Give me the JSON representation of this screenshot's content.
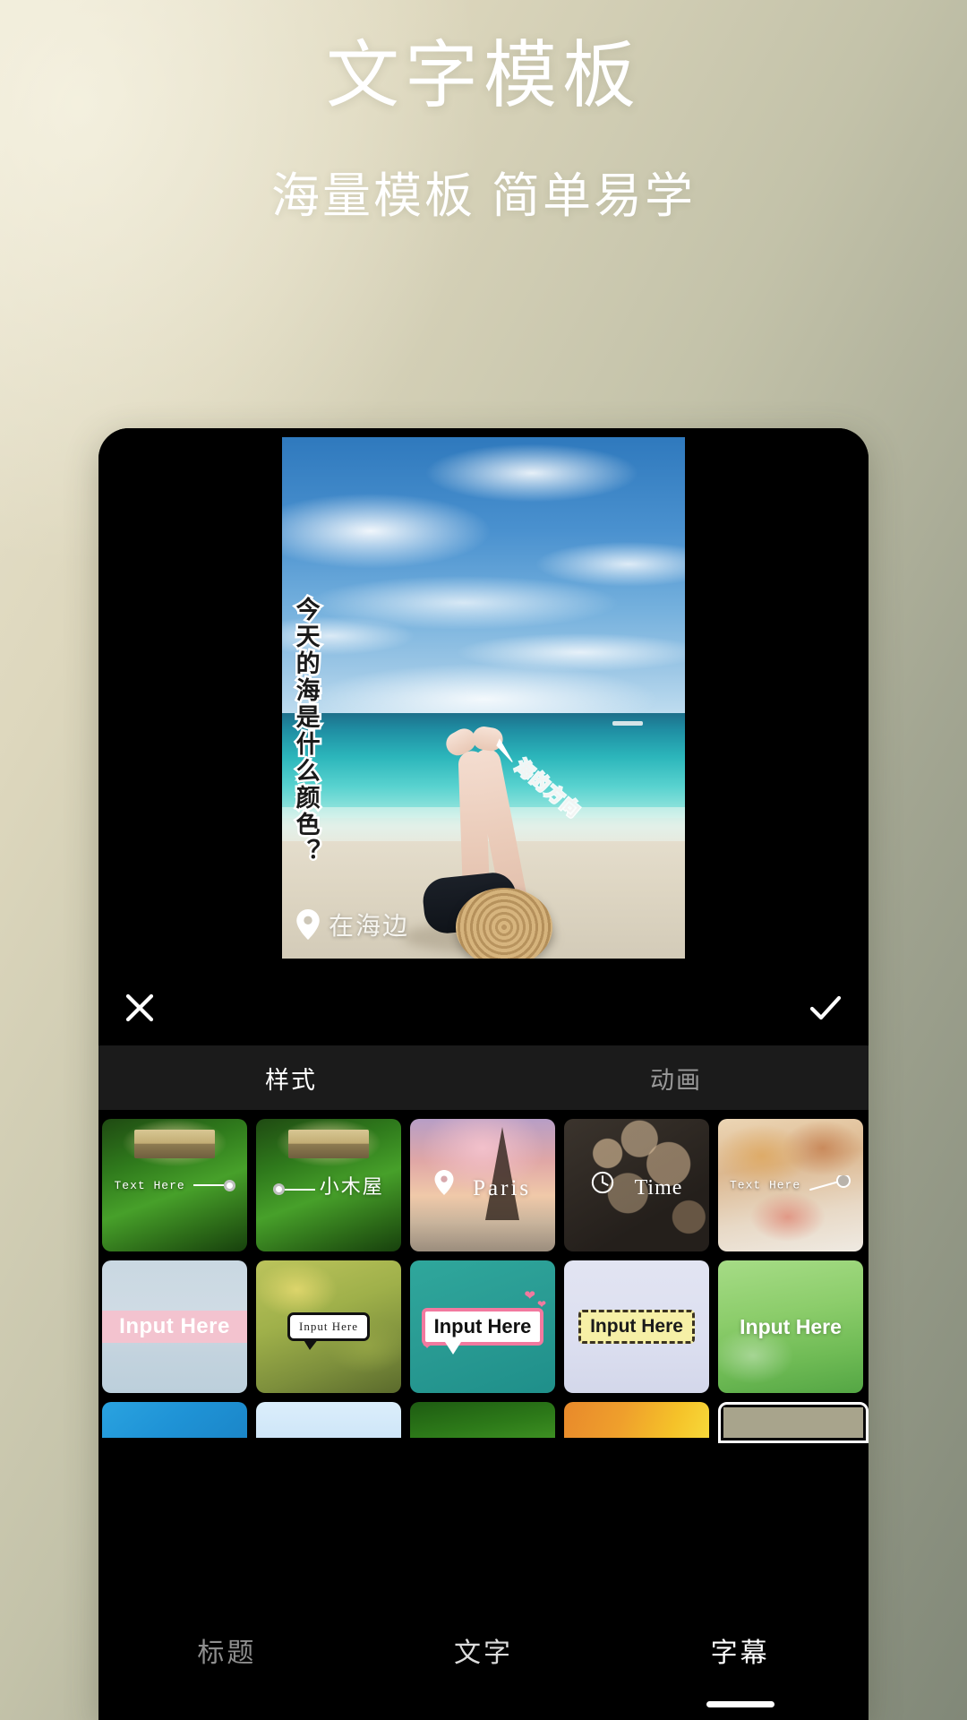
{
  "promo": {
    "headline": "文字模板",
    "subhead": "海量模板 简单易学"
  },
  "colors": {
    "bg_start": "#eae4cf",
    "bg_end": "#818878",
    "phone_bg": "#000000",
    "tabbar_bg": "#1b1b1b",
    "accent_white": "#ffffff",
    "muted_text": "#9a9a9a",
    "pink_accent": "#f2799f",
    "yellow_tag": "#f6f0a6"
  },
  "preview": {
    "vertical_caption": "今天的海是什么颜色？",
    "diagonal_caption": "海的方向",
    "diagonal_arrow_icon": "arrow-up-left-icon",
    "location_icon": "location-pin-icon",
    "location_label": "在海边"
  },
  "actions": {
    "close_icon": "close-x-icon",
    "confirm_icon": "checkmark-icon"
  },
  "tabs": [
    {
      "label": "样式",
      "active": true
    },
    {
      "label": "动画",
      "active": false
    }
  ],
  "templates": {
    "rows": [
      [
        {
          "label": "Text Here",
          "style": "forest-connector-right",
          "icon": "connector-dot-icon"
        },
        {
          "label": "小木屋",
          "style": "forest-connector-left",
          "icon": "connector-dot-icon"
        },
        {
          "label": "Paris",
          "style": "paris-pin",
          "icon": "location-pin-icon"
        },
        {
          "label": "Time",
          "style": "bokeh-clock",
          "icon": "clock-icon"
        },
        {
          "label": "Text Here",
          "style": "food-pin-line",
          "icon": "pin-line-icon"
        }
      ],
      [
        {
          "label": "Input Here",
          "style": "steel-pink-band",
          "icon": ""
        },
        {
          "label": "Input Here",
          "style": "autumn-speech-bubble",
          "icon": "speech-bubble-icon"
        },
        {
          "label": "Input Here",
          "style": "teal-pink-bubble",
          "icon": "heart-icon"
        },
        {
          "label": "Input Here",
          "style": "lavender-dashed-tag",
          "icon": "paw-icon"
        },
        {
          "label": "Input Here",
          "style": "green-soft-white",
          "icon": "brush-icon"
        }
      ],
      [
        {
          "label": "",
          "style": "blue",
          "icon": ""
        },
        {
          "label": "",
          "style": "light-blue",
          "icon": ""
        },
        {
          "label": "",
          "style": "dark-green",
          "icon": ""
        },
        {
          "label": "",
          "style": "orange",
          "icon": ""
        },
        {
          "label": "",
          "style": "sandy-framed",
          "icon": ""
        }
      ]
    ]
  },
  "bottom_nav": [
    {
      "label": "标题",
      "state": "idle"
    },
    {
      "label": "文字",
      "state": "semi"
    },
    {
      "label": "字幕",
      "state": "active"
    }
  ]
}
